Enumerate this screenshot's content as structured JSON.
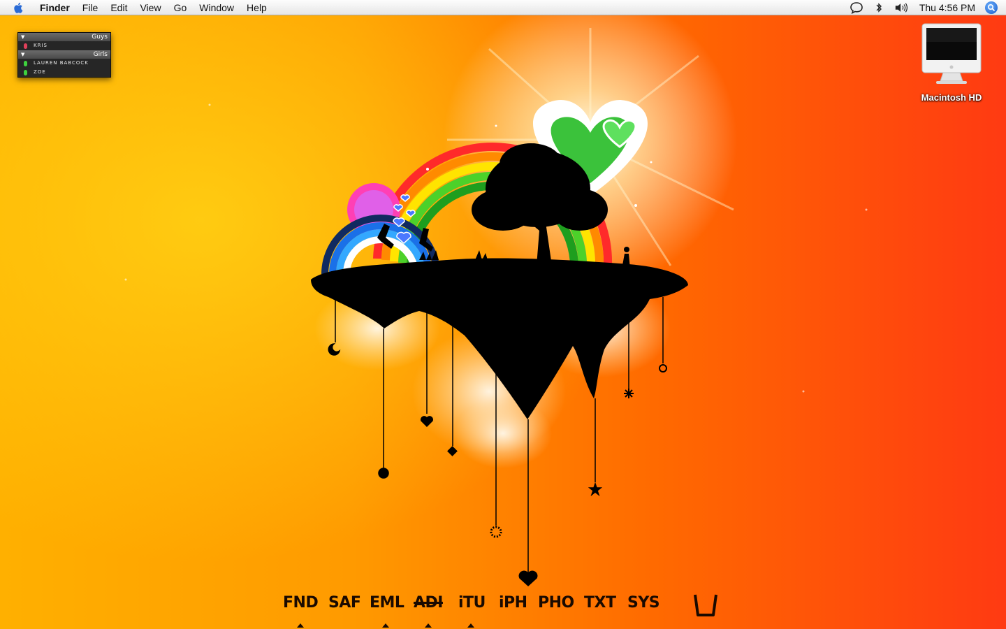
{
  "menubar": {
    "apple_icon": "apple-logo-icon",
    "app_name": "Finder",
    "menus": [
      "File",
      "Edit",
      "View",
      "Go",
      "Window",
      "Help"
    ],
    "status_icons": [
      "speech-bubble-icon",
      "bluetooth-icon",
      "volume-icon"
    ],
    "clock": "Thu 4:56 PM",
    "spotlight_icon": "spotlight-search-icon"
  },
  "buddy_list": {
    "groups": [
      {
        "name": "Guys",
        "members": [
          {
            "name": "KRIS",
            "status_color": "#e0405a"
          }
        ]
      },
      {
        "name": "Girls",
        "members": [
          {
            "name": "LAUREN BABCOCK",
            "status_color": "#3ed23e"
          },
          {
            "name": "ZOE",
            "status_color": "#3ed23e"
          }
        ]
      }
    ]
  },
  "desktop": {
    "drive_label": "Macintosh HD",
    "drive_icon": "imac-drive-icon"
  },
  "dock": {
    "items": [
      {
        "label": "FND",
        "running": true
      },
      {
        "label": "SAF",
        "running": false
      },
      {
        "label": "EML",
        "running": true
      },
      {
        "label": "ADI",
        "running": true
      },
      {
        "label": "iTU",
        "running": true
      },
      {
        "label": "iPH",
        "running": false
      },
      {
        "label": "PHO",
        "running": false
      },
      {
        "label": "TXT",
        "running": false
      },
      {
        "label": "SYS",
        "running": false
      }
    ],
    "trash_icon": "trash-icon"
  },
  "colors": {
    "accent_orange": "#ff9a00",
    "accent_red": "#ff3a12",
    "heart_green": "#3bc23b"
  }
}
